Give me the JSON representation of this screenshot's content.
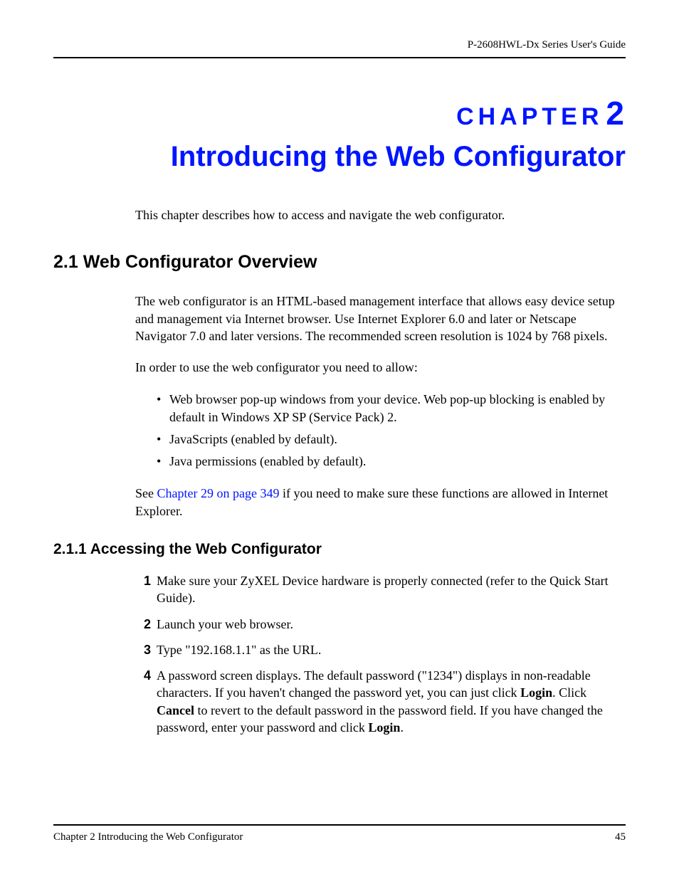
{
  "header": {
    "guide_title": "P-2608HWL-Dx Series User's Guide"
  },
  "chapter": {
    "label": "CHAPTER",
    "number": "2",
    "title": "Introducing the Web Configurator"
  },
  "intro": "This chapter describes how to access and navigate the web configurator.",
  "section21": {
    "heading": "2.1  Web Configurator Overview",
    "para1": "The web configurator is an HTML-based management interface that allows easy device setup and management via Internet browser. Use Internet Explorer 6.0 and later or Netscape Navigator 7.0 and later versions. The recommended screen resolution is 1024 by 768 pixels.",
    "para2": "In order to use the web configurator you need to allow:",
    "bullets": [
      "Web browser pop-up windows from your device. Web pop-up blocking is enabled by default in Windows XP SP (Service Pack) 2.",
      "JavaScripts (enabled by default).",
      "Java permissions (enabled by default)."
    ],
    "see_prefix": "See ",
    "see_link": "Chapter 29 on page 349",
    "see_suffix": " if you need to make sure these functions are allowed in Internet Explorer."
  },
  "section211": {
    "heading": "2.1.1  Accessing the Web Configurator",
    "steps": {
      "n1": "1",
      "t1": "Make sure your ZyXEL Device hardware is properly connected (refer to the Quick Start Guide).",
      "n2": "2",
      "t2": "Launch your web browser.",
      "n3": "3",
      "t3": "Type \"192.168.1.1\" as the URL.",
      "n4": "4",
      "t4a": "A password screen displays. The default password (\"1234\") displays in non-readable characters. If you haven't changed the password yet, you can just click ",
      "t4_login1": "Login",
      "t4b": ". Click ",
      "t4_cancel": "Cancel",
      "t4c": " to revert to the default password in the password field. If you have changed the password, enter your password and click ",
      "t4_login2": "Login",
      "t4d": "."
    }
  },
  "footer": {
    "left": "Chapter 2 Introducing the Web Configurator",
    "right": "45"
  }
}
